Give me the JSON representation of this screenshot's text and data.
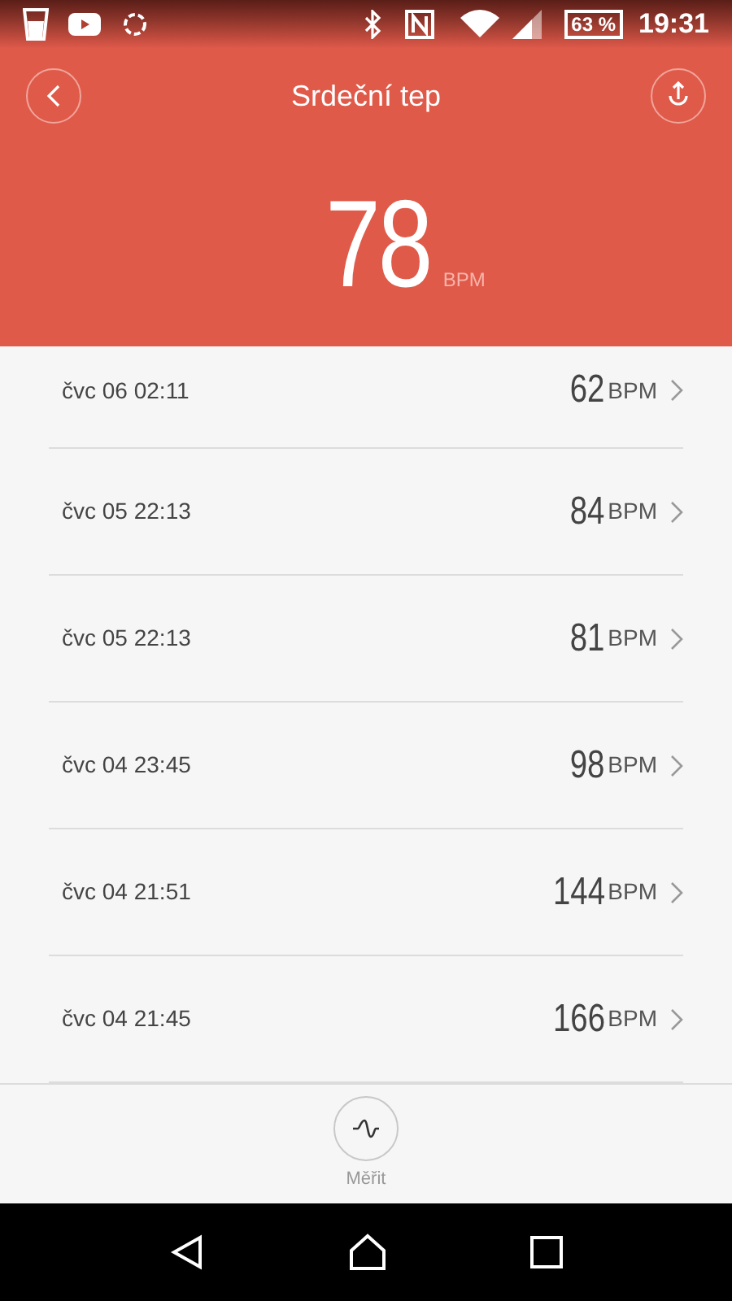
{
  "status_bar": {
    "battery": "63 %",
    "time": "19:31"
  },
  "header": {
    "title": "Srdeční tep"
  },
  "current": {
    "value": "78",
    "unit": "BPM"
  },
  "records": [
    {
      "date": "čvc 06 02:11",
      "value": "62",
      "unit": "BPM"
    },
    {
      "date": "čvc 05 22:13",
      "value": "84",
      "unit": "BPM"
    },
    {
      "date": "čvc 05 22:13",
      "value": "81",
      "unit": "BPM"
    },
    {
      "date": "čvc 04 23:45",
      "value": "98",
      "unit": "BPM"
    },
    {
      "date": "čvc 04 21:51",
      "value": "144",
      "unit": "BPM"
    },
    {
      "date": "čvc 04 21:45",
      "value": "166",
      "unit": "BPM"
    }
  ],
  "measure": {
    "label": "Měřit"
  }
}
